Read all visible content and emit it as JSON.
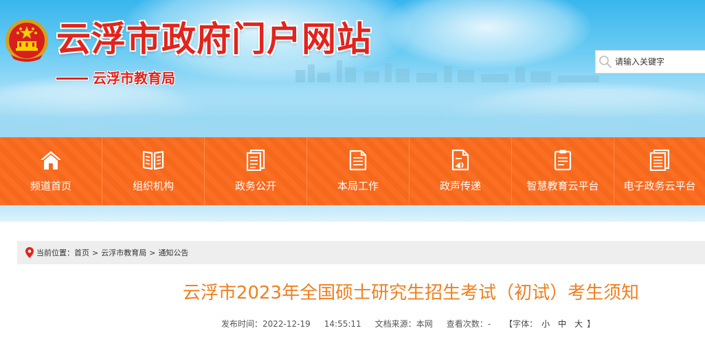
{
  "header": {
    "site_title": "云浮市政府门户网站",
    "sub_title": "云浮市教育局",
    "search": {
      "placeholder": "请输入关键字"
    }
  },
  "nav": {
    "items": [
      {
        "label": "频道首页",
        "icon": "home-icon"
      },
      {
        "label": "组织机构",
        "icon": "book-icon"
      },
      {
        "label": "政务公开",
        "icon": "document-icon"
      },
      {
        "label": "本局工作",
        "icon": "notepad-icon"
      },
      {
        "label": "政声传递",
        "icon": "file-broadcast-icon"
      },
      {
        "label": "智慧教育云平台",
        "icon": "clipboard-icon"
      },
      {
        "label": "电子政务云平台",
        "icon": "list-document-icon"
      }
    ]
  },
  "breadcrumb": {
    "prefix": "当前位置：",
    "items": [
      "首页",
      "云浮市教育局",
      "通知公告"
    ],
    "separator": ">"
  },
  "article": {
    "title": "云浮市2023年全国硕士研究生招生考试（初试）考生须知",
    "publish_label": "发布时间：",
    "publish_date": "2022-12-19",
    "publish_time": "14:55:11",
    "source_label": "文档来源：",
    "source": "本网",
    "views_label": "查看次数：",
    "views": "-",
    "font_label": "【字体：",
    "font_small": "小",
    "font_medium": "中",
    "font_large": "大",
    "font_close": "】"
  },
  "colors": {
    "brand_red": "#e2241c",
    "nav_orange": "#fb6a1c",
    "title_orange": "#f07f1e",
    "breadcrumb_bg": "#eeeeee"
  }
}
